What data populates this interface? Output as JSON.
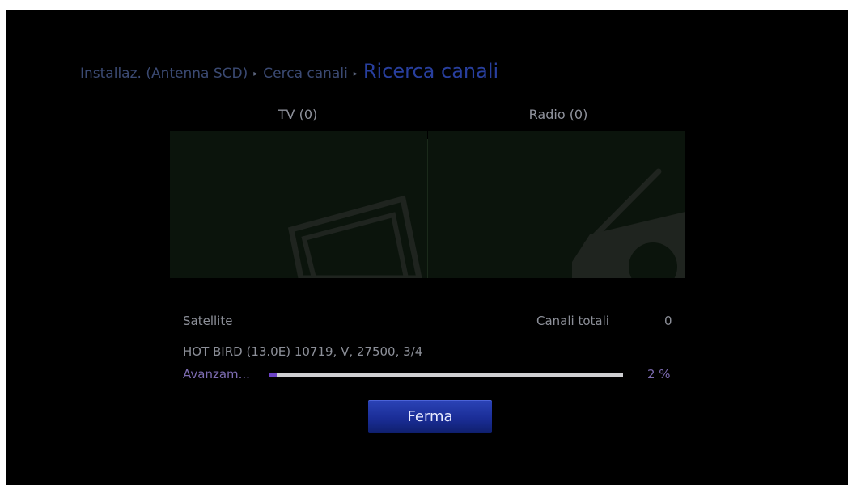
{
  "breadcrumb": {
    "items": [
      "Installaz. (Antenna SCD)",
      "Cerca canali"
    ],
    "separator": "▸",
    "current": "Ricerca canali"
  },
  "panels": {
    "tv_label": "TV (0)",
    "radio_label": "Radio (0)",
    "tv_icon": "tv-icon",
    "radio_icon": "radio-icon"
  },
  "status": {
    "satellite_label": "Satellite",
    "total_channels_label": "Canali totali",
    "total_channels_value": "0",
    "transponder": "HOT BIRD (13.0E) 10719, V, 27500, 3/4",
    "progress_label": "Avanzam...",
    "progress_percent_text": "2 %",
    "progress_fraction": 0.02
  },
  "buttons": {
    "stop_label": "Ferma"
  },
  "colors": {
    "background": "#000000",
    "breadcrumb_current": "#283f9e",
    "progress_fill": "#6c43c6",
    "button": "#1a2d96"
  }
}
